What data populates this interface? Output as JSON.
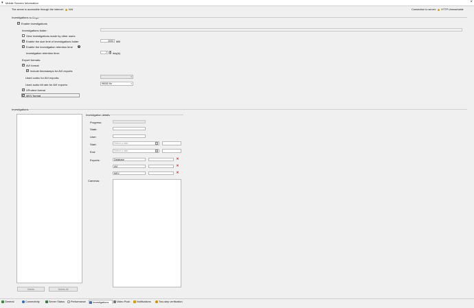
{
  "window": {
    "title": "Mobile Servers Information"
  },
  "status": {
    "server_label": "The server is accessible through the internet:",
    "server_value": "N/A",
    "connection_label": "Connection to server:",
    "connection_value": "HTTP",
    "connection_status": "Unreachable"
  },
  "settings": {
    "section_title": "Investigations settings",
    "enable_investigations": "Enable investigations",
    "folder_label": "Investigations folder:",
    "view_by_other_users": "View investigations made by other users",
    "size_limit_label": "Enable the size limit of investigations folder",
    "size_limit_value": "2000",
    "size_limit_unit": "MB",
    "retention_enable": "Enable the investigation retention time",
    "retention_label": "Investigation retention time:",
    "retention_value": "7",
    "retention_unit": "day(s)",
    "export_formats_label": "Export formats:",
    "avi_format": "AVI format",
    "include_timestamps": "Include timestamps for AVI exports",
    "codec_label": "Used codec for AVI exports:",
    "audio_bitrate_label": "Used audio bit rate for AVI exports:",
    "audio_bitrate_value": "96000 Hz",
    "xprotect_format": "XProtect format",
    "mkv_format": "MKV format"
  },
  "investigations": {
    "section_title": "Investigations",
    "delete_button": "Delete",
    "delete_all_button": "Delete All"
  },
  "details": {
    "title": "Investigation details",
    "progress_label": "Progress:",
    "state_label": "State:",
    "user_label": "User:",
    "start_label": "Start:",
    "end_label": "End:",
    "date_placeholder": "Select a date",
    "exports_label": "Exports:",
    "exports": [
      "Database",
      "AVI",
      "MKV"
    ],
    "cameras_label": "Cameras:"
  },
  "tabs": [
    {
      "label": "General",
      "color": "#3a8a3a"
    },
    {
      "label": "Connectivity",
      "color": "#2a6ac0"
    },
    {
      "label": "Server Status",
      "color": "#3a7a3a"
    },
    {
      "label": "Performance",
      "color": "#888888"
    },
    {
      "label": "Investigations",
      "color": "#4a6ab0"
    },
    {
      "label": "Video Push",
      "color": "#777777"
    },
    {
      "label": "Notifications",
      "color": "#d4a000"
    },
    {
      "label": "Two-step verification",
      "color": "#d49000"
    }
  ],
  "colors": {
    "status_dot": "#e2a100",
    "delete_x": "#dd2222"
  }
}
